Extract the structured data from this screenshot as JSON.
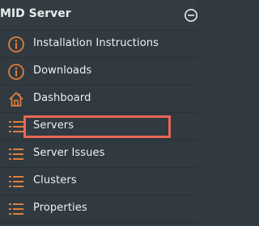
{
  "header": {
    "title": "MID Server",
    "collapse_icon": "minus-circle-icon"
  },
  "items": [
    {
      "label": "Installation Instructions",
      "icon": "info-circle-icon"
    },
    {
      "label": "Downloads",
      "icon": "info-circle-icon"
    },
    {
      "label": "Dashboard",
      "icon": "home-icon"
    },
    {
      "label": "Servers",
      "icon": "list-icon",
      "highlighted": true
    },
    {
      "label": "Server Issues",
      "icon": "list-icon"
    },
    {
      "label": "Clusters",
      "icon": "list-icon"
    },
    {
      "label": "Properties",
      "icon": "list-icon"
    }
  ],
  "colors": {
    "background": "#303a40",
    "text": "#eef1f1",
    "icon": "#e07d3c",
    "highlight_border": "#e86756"
  }
}
